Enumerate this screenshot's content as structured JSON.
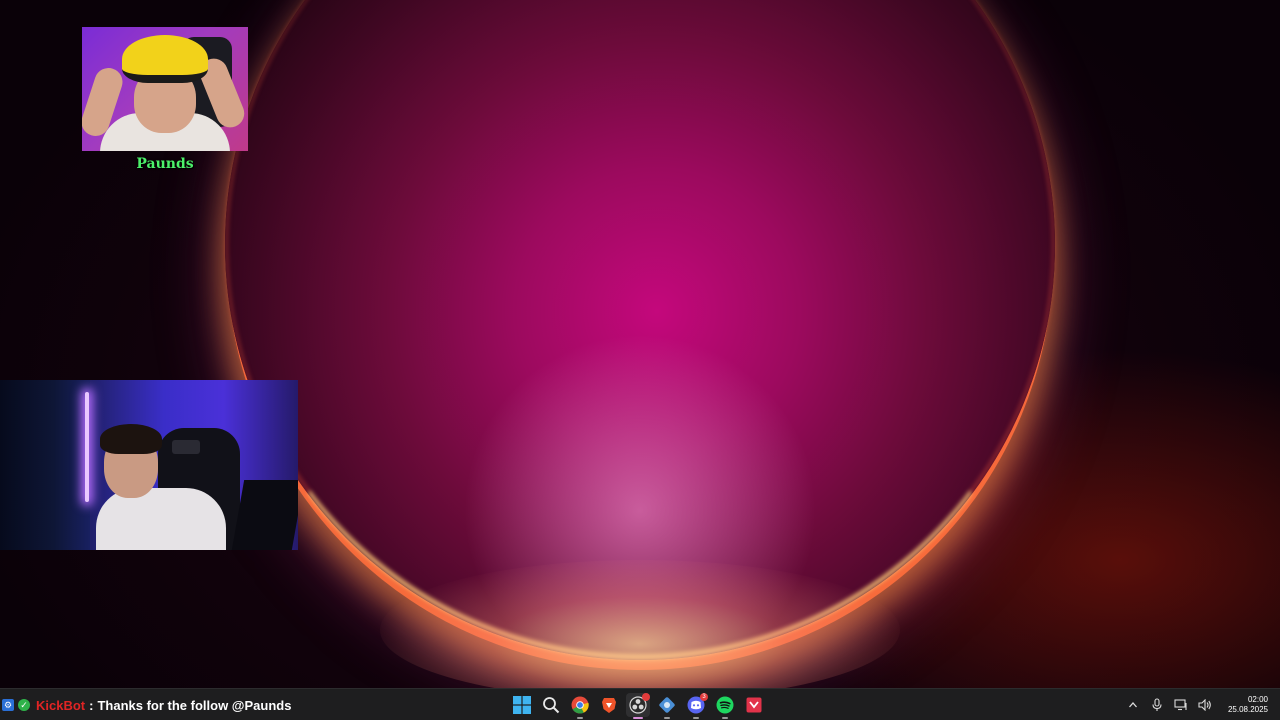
{
  "overlay": {
    "avatar_name": "Paunds",
    "avatar_name_color": "#4cf06a"
  },
  "chat": {
    "user": "KickBot",
    "separator": ":",
    "message": "Thanks for the follow @Paunds",
    "user_color": "#e02424",
    "badges": [
      "bot-badge-icon",
      "verified-check-icon"
    ]
  },
  "taskbar": {
    "apps": [
      {
        "name": "start-windows-icon",
        "active": false
      },
      {
        "name": "search-icon",
        "active": false
      },
      {
        "name": "chrome-icon",
        "active": false
      },
      {
        "name": "brave-browser-icon",
        "active": false
      },
      {
        "name": "obs-studio-icon",
        "active": true
      },
      {
        "name": "app-settings-icon",
        "active": false
      },
      {
        "name": "discord-icon",
        "active": false,
        "badge": "3"
      },
      {
        "name": "spotify-icon",
        "active": false
      },
      {
        "name": "red-app-icon",
        "active": false
      }
    ],
    "tray": [
      "chevron-up-icon",
      "microphone-icon",
      "network-icon",
      "speaker-icon"
    ],
    "time": "02:00",
    "date": "25.08.2025"
  },
  "colors": {
    "taskbar_bg": "#1e1e1f",
    "accent_active": "#d98fd9"
  }
}
